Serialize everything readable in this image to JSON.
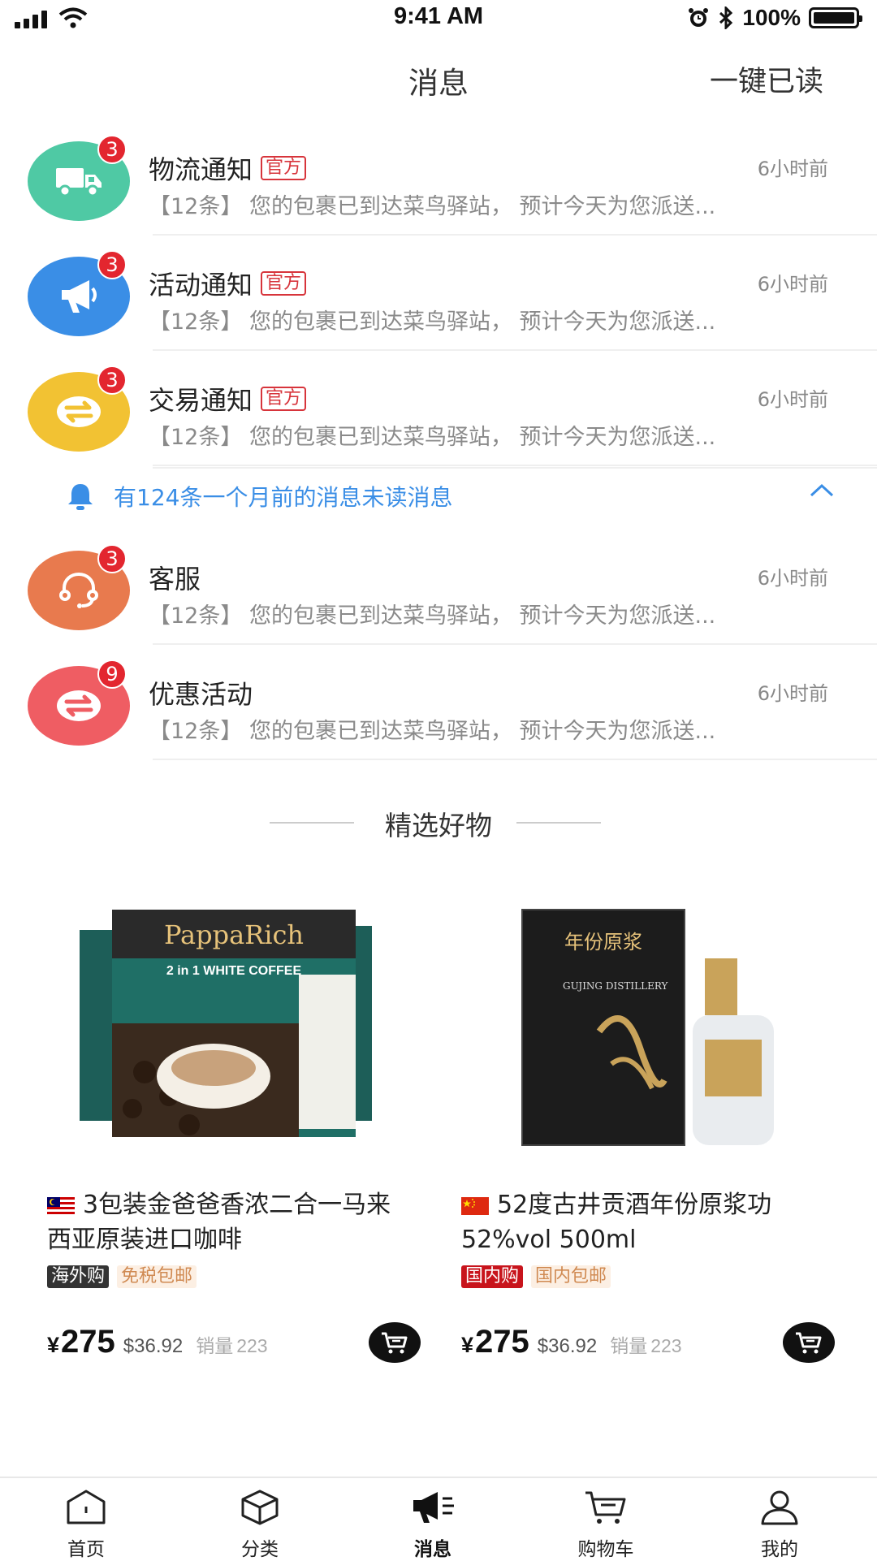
{
  "status_bar": {
    "time": "9:41 AM",
    "battery": "100%"
  },
  "header": {
    "title": "消息",
    "mark_all_read": "一键已读"
  },
  "messages": [
    {
      "title": "物流通知",
      "tag": "官方",
      "time": "6小时前",
      "badge": "3",
      "preview": "【12条】 您的包裹已到达菜鸟驿站， 预计今天为您派送...",
      "icon": "truck-icon",
      "color": "#4fc9a4"
    },
    {
      "title": "活动通知",
      "tag": "官方",
      "time": "6小时前",
      "badge": "3",
      "preview": "【12条】 您的包裹已到达菜鸟驿站， 预计今天为您派送...",
      "icon": "megaphone-icon",
      "color": "#3a8ee6"
    },
    {
      "title": "交易通知",
      "tag": "官方",
      "time": "6小时前",
      "badge": "3",
      "preview": "【12条】 您的包裹已到达菜鸟驿站， 预计今天为您派送...",
      "icon": "exchange-icon",
      "color": "#f2c233"
    },
    {
      "title": "客服",
      "tag": "",
      "time": "6小时前",
      "badge": "3",
      "preview": "【12条】 您的包裹已到达菜鸟驿站， 预计今天为您派送...",
      "icon": "headset-icon",
      "color": "#e87a4e"
    },
    {
      "title": "优惠活动",
      "tag": "",
      "time": "6小时前",
      "badge": "9",
      "preview": "【12条】 您的包裹已到达菜鸟驿站， 预计今天为您派送...",
      "icon": "exchange-icon",
      "color": "#ef5d63"
    }
  ],
  "notice": {
    "text": "有124条一个月前的消息未读消息"
  },
  "featured": {
    "title": "精选好物"
  },
  "products": [
    {
      "flag": "malaysia-flag",
      "name": "3包装金爸爸香浓二合一马来西亚原装进口咖啡",
      "tag1": "海外购",
      "tag1_color": "#333333",
      "tag2": "免税包邮",
      "price_symbol": "¥",
      "price": "275",
      "usd": "$36.92",
      "sales_label": "销量",
      "sales": "223",
      "image_brand": "PappaRich",
      "image_subtitle": "2 in 1 WHITE COFFEE"
    },
    {
      "flag": "china-flag",
      "name": "52度古井贡酒年份原浆功52%vol 500ml",
      "tag1": "国内购",
      "tag1_color": "#c8141c",
      "tag2": "国内包邮",
      "price_symbol": "¥",
      "price": "275",
      "usd": "$36.92",
      "sales_label": "销量",
      "sales": "223",
      "image_brand": "年份原浆",
      "image_subtitle": "GUJING DISTILLERY"
    }
  ],
  "tabs": [
    {
      "label": "首页",
      "icon": "home-icon"
    },
    {
      "label": "分类",
      "icon": "box-icon"
    },
    {
      "label": "消息",
      "icon": "megaphone-icon",
      "active": true
    },
    {
      "label": "购物车",
      "icon": "cart-icon"
    },
    {
      "label": "我的",
      "icon": "user-icon"
    }
  ]
}
